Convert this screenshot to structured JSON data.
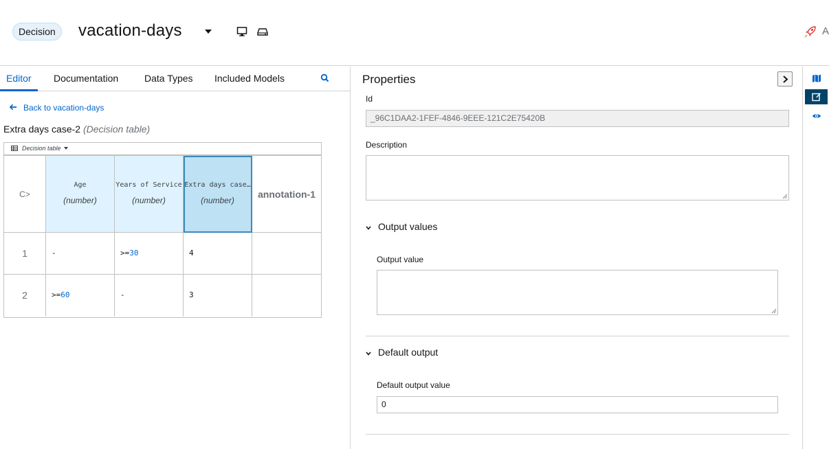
{
  "header": {
    "badge": "Decision",
    "title": "vacation-days",
    "truncated_text": "A",
    "icons": [
      "caret-down-icon",
      "desktop-icon",
      "drive-icon",
      "rocket-icon"
    ]
  },
  "tabs": [
    {
      "label": "Editor",
      "active": true
    },
    {
      "label": "Documentation",
      "active": false
    },
    {
      "label": "Data Types",
      "active": false
    },
    {
      "label": "Included Models",
      "active": false
    }
  ],
  "editor": {
    "back_link": "Back to vacation-days",
    "table_name": "Extra days case-2",
    "table_kind": "(Decision table)",
    "toolbar_label": "Decision table",
    "hit_policy": "C>",
    "columns": [
      {
        "name": "Age",
        "type": "(number)",
        "kind": "input"
      },
      {
        "name": "Years of Service",
        "type": "(number)",
        "kind": "input"
      },
      {
        "name": "Extra days case…",
        "type": "(number)",
        "kind": "output"
      },
      {
        "name": "annotation-1",
        "type": "",
        "kind": "annotation"
      }
    ],
    "rows": [
      {
        "num": "1",
        "age_op": "-",
        "age_num": "",
        "yos_op": ">=",
        "yos_num": "30",
        "out": "4",
        "ann": ""
      },
      {
        "num": "2",
        "age_op": ">=",
        "age_num": "60",
        "yos_op": "-",
        "yos_num": "",
        "out": "3",
        "ann": ""
      }
    ]
  },
  "properties": {
    "title": "Properties",
    "id_label": "Id",
    "id_value": "_96C1DAA2-1FEF-4846-9EEE-121C2E75420B",
    "description_label": "Description",
    "description_value": "",
    "output_values_header": "Output values",
    "output_value_label": "Output value",
    "output_value_value": "",
    "default_output_header": "Default output",
    "default_output_value_label": "Default output value",
    "default_output_value": "0"
  },
  "rail": {
    "icons": [
      "map-icon",
      "edit-icon",
      "eye-icon"
    ],
    "active": "edit-icon"
  },
  "colors": {
    "accent": "#0066cc",
    "input_header_bg": "#def3ff",
    "output_header_bg": "#bee1f4",
    "rail_active": "#004368"
  }
}
